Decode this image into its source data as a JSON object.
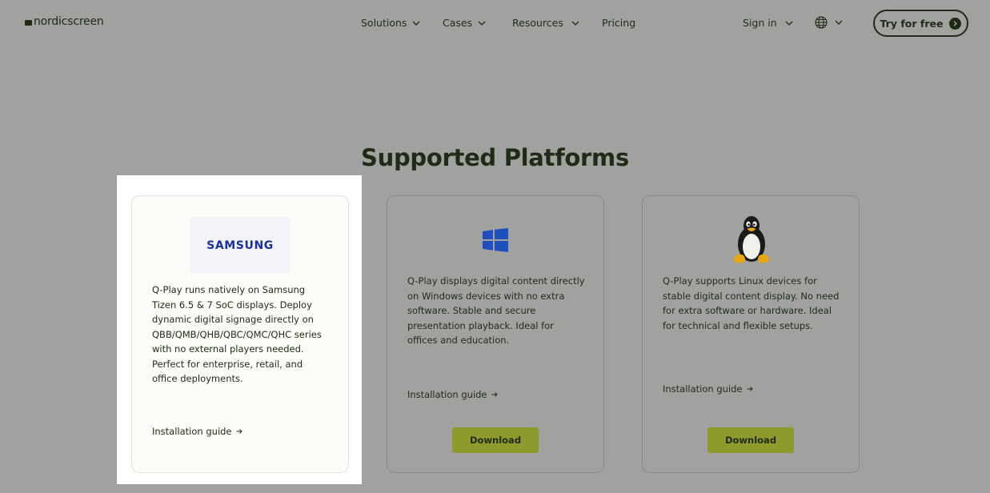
{
  "header": {
    "brand": "nordicscreen",
    "nav": [
      {
        "label": "Solutions"
      },
      {
        "label": "Cases"
      },
      {
        "label": "Resources"
      },
      {
        "label": "Pricing"
      }
    ],
    "sign_in": "Sign in",
    "cta": "Try for free"
  },
  "section": {
    "title": "Supported Platforms"
  },
  "cards": [
    {
      "logo_text": "SAMSUNG",
      "description": "Q-Play runs natively on Samsung Tizen 6.5 & 7 SoC displays. Deploy dynamic digital signage directly on QBB/QMB/QHB/QBC/QMC/QHC series with no external players needed. Perfect for enterprise, retail, and office deployments.",
      "link": "Installation guide"
    },
    {
      "description": "Q-Play displays digital content directly on Windows devices with no extra software. Stable and secure presentation playback. Ideal for offices and education.",
      "link": "Installation guide",
      "button": "Download"
    },
    {
      "description": "Q-Play supports Linux devices for stable digital content display. No need for extra software or hardware. Ideal for technical and flexible setups.",
      "link": "Installation guide",
      "button": "Download"
    }
  ],
  "colors": {
    "overlay_background": "#a1a29f",
    "text_dark": "#1f2a17",
    "download_button": "#8e9a2c",
    "samsung_blue": "#1a2fa0",
    "windows_blue": "#1e4fbb"
  },
  "icons": [
    "chevron-down-icon",
    "globe-icon",
    "arrow-right-icon",
    "windows-logo",
    "linux-tux-logo"
  ]
}
